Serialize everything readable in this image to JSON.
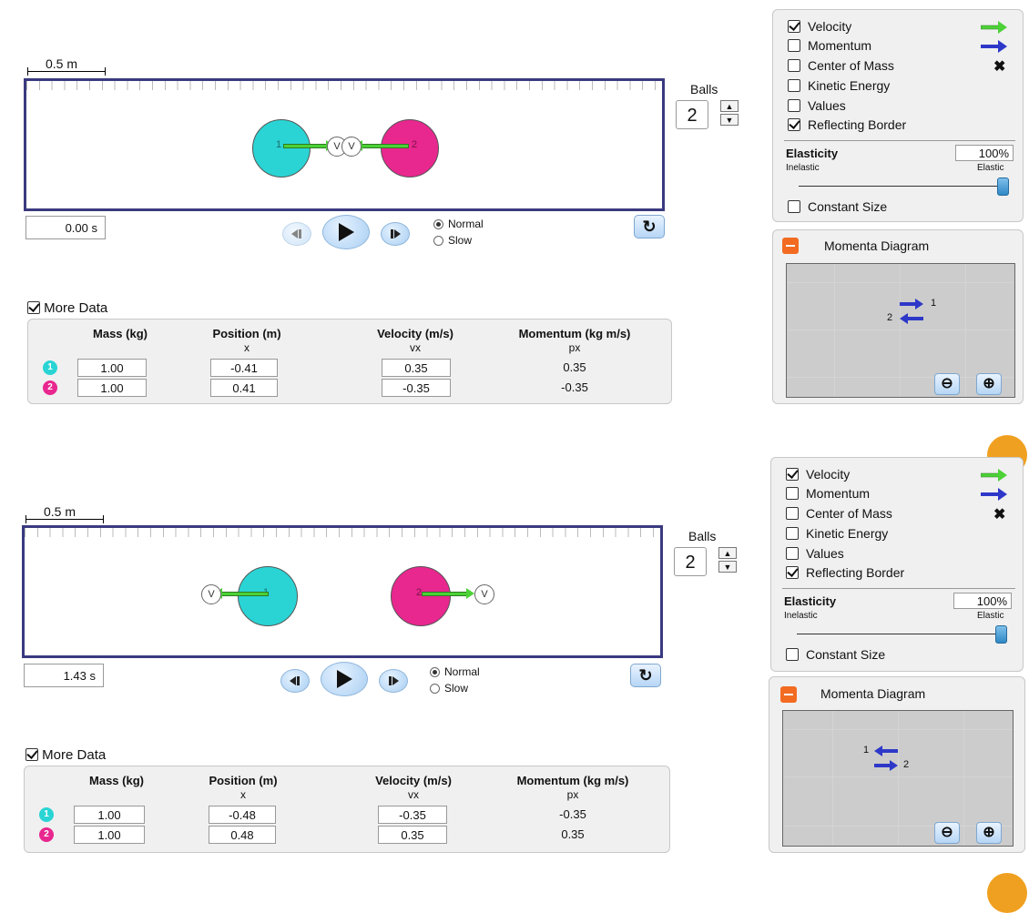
{
  "panels": [
    {
      "scale_label": "0.5 m",
      "time": "0.00 s",
      "balls_label": "Balls",
      "balls_count": "2",
      "speed_options": [
        "Normal",
        "Slow"
      ],
      "selected_speed": "Normal",
      "more_data_label": "More Data",
      "headers": {
        "mass": "Mass (kg)",
        "position": "Position (m)",
        "velocity": "Velocity (m/s)",
        "momentum": "Momentum (kg m/s)"
      },
      "subheaders": {
        "position": "x",
        "velocity": "vx",
        "momentum": "px"
      },
      "rows": [
        {
          "id": "1",
          "mass": "1.00",
          "position": "-0.41",
          "velocity": "0.35",
          "momentum": "0.35"
        },
        {
          "id": "2",
          "mass": "1.00",
          "position": "0.41",
          "velocity": "-0.35",
          "momentum": "-0.35"
        }
      ],
      "options": [
        {
          "label": "Velocity",
          "checked": true
        },
        {
          "label": "Momentum",
          "checked": false
        },
        {
          "label": "Center of Mass",
          "checked": false
        },
        {
          "label": "Kinetic Energy",
          "checked": false
        },
        {
          "label": "Values",
          "checked": false
        },
        {
          "label": "Reflecting Border",
          "checked": true
        }
      ],
      "elasticity_label": "Elasticity",
      "elasticity_value": "100%",
      "inelastic_label": "Inelastic",
      "elastic_label": "Elastic",
      "elasticity_fraction": 1.0,
      "constant_size_label": "Constant Size",
      "momenta_title": "Momenta Diagram",
      "momenta_labels": [
        "1",
        "2"
      ],
      "ball_marks": [
        "1",
        "2"
      ],
      "velocity_marks": [
        "V",
        "V"
      ]
    },
    {
      "scale_label": "0.5 m",
      "time": "1.43 s",
      "balls_label": "Balls",
      "balls_count": "2",
      "speed_options": [
        "Normal",
        "Slow"
      ],
      "selected_speed": "Normal",
      "more_data_label": "More Data",
      "headers": {
        "mass": "Mass (kg)",
        "position": "Position (m)",
        "velocity": "Velocity (m/s)",
        "momentum": "Momentum (kg m/s)"
      },
      "subheaders": {
        "position": "x",
        "velocity": "vx",
        "momentum": "px"
      },
      "rows": [
        {
          "id": "1",
          "mass": "1.00",
          "position": "-0.48",
          "velocity": "-0.35",
          "momentum": "-0.35"
        },
        {
          "id": "2",
          "mass": "1.00",
          "position": "0.48",
          "velocity": "0.35",
          "momentum": "0.35"
        }
      ],
      "options": [
        {
          "label": "Velocity",
          "checked": true
        },
        {
          "label": "Momentum",
          "checked": false
        },
        {
          "label": "Center of Mass",
          "checked": false
        },
        {
          "label": "Kinetic Energy",
          "checked": false
        },
        {
          "label": "Values",
          "checked": false
        },
        {
          "label": "Reflecting Border",
          "checked": true
        }
      ],
      "elasticity_label": "Elasticity",
      "elasticity_value": "100%",
      "inelastic_label": "Inelastic",
      "elastic_label": "Elastic",
      "elasticity_fraction": 1.0,
      "constant_size_label": "Constant Size",
      "momenta_title": "Momenta Diagram",
      "momenta_labels": [
        "1",
        "2"
      ],
      "ball_marks": [
        "1",
        "2"
      ],
      "velocity_marks": [
        "V",
        "V"
      ]
    }
  ],
  "colors": {
    "ball1": "#2ad4d4",
    "ball2": "#e8278f",
    "velocity_arrow": "#4cd137",
    "momentum_arrow": "#2e38c8",
    "board_border": "#3a3a80",
    "collapse": "#f26b21"
  },
  "icons": [
    "step-back-icon",
    "play-icon",
    "step-forward-icon",
    "reset-icon",
    "zoom-out-icon",
    "zoom-in-icon",
    "center-of-mass-x-icon",
    "checkmark-icon"
  ]
}
